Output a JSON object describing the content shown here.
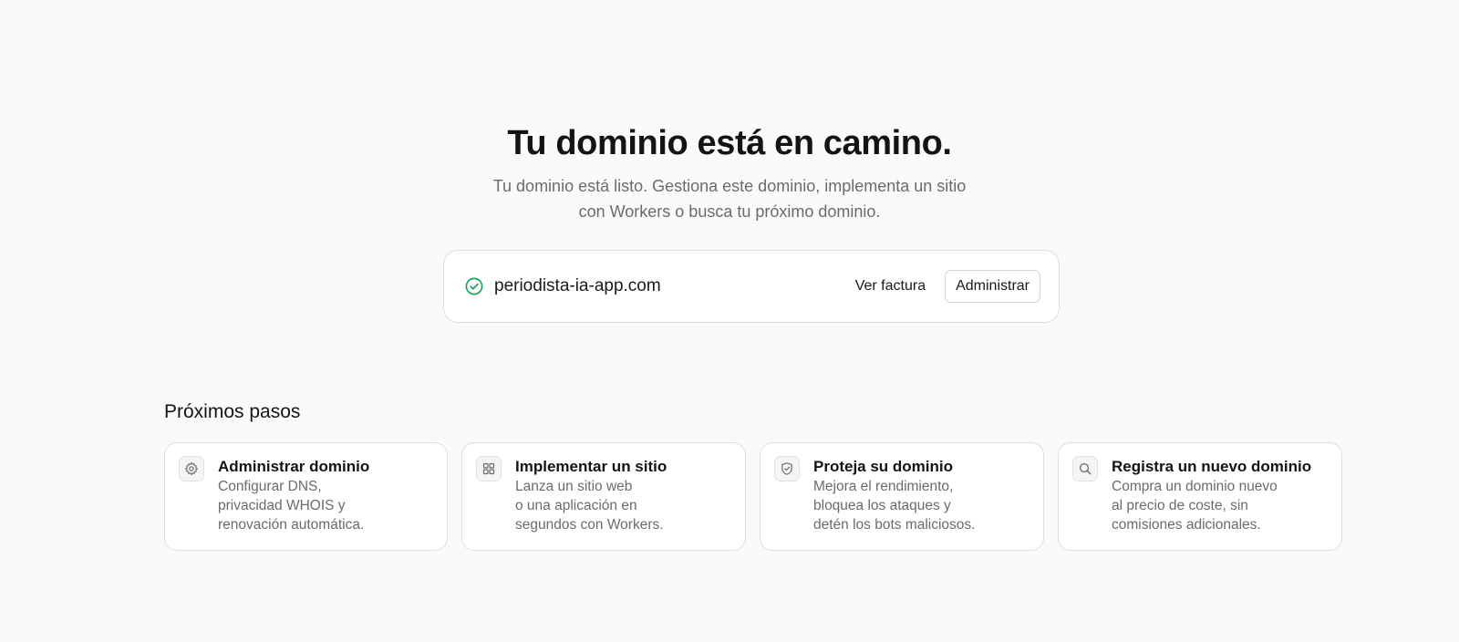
{
  "hero": {
    "title": "Tu dominio está en camino.",
    "subtitle": "Tu dominio está listo. Gestiona este dominio, implementa un sitio con Workers o busca tu próximo dominio."
  },
  "domain_card": {
    "status_icon": "check-circle-icon",
    "domain": "periodista-ia-app.com",
    "invoice_label": "Ver factura",
    "manage_label": "Administrar",
    "status_color": "#1aa35c"
  },
  "next_steps": {
    "title": "Próximos pasos",
    "cards": [
      {
        "icon": "gear-icon",
        "title": "Administrar dominio",
        "description": "Configurar DNS,\nprivacidad WHOIS y\nrenovación automática."
      },
      {
        "icon": "grid-icon",
        "title": "Implementar un sitio",
        "description": "Lanza un sitio web\no una aplicación en\nsegundos con Workers."
      },
      {
        "icon": "shield-check-icon",
        "title": "Proteja su dominio",
        "description": "Mejora el rendimiento,\nbloquea los ataques y\ndetén los bots maliciosos."
      },
      {
        "icon": "search-icon",
        "title": "Registra un nuevo dominio",
        "description": "Compra un dominio nuevo\nal precio de coste, sin\ncomisiones adicionales."
      }
    ]
  }
}
